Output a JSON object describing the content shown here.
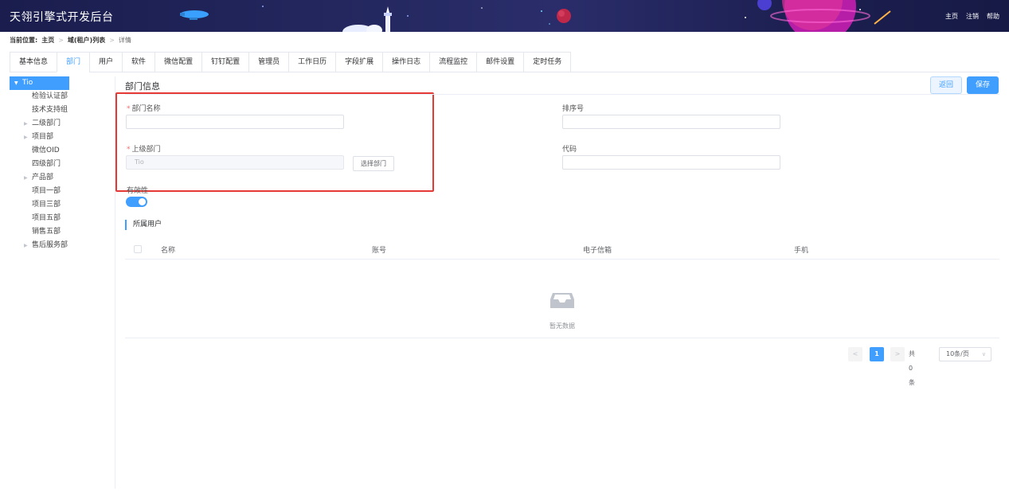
{
  "header": {
    "title": "天翎引擎式开发后台",
    "links": [
      "主页",
      "注销",
      "帮助"
    ]
  },
  "breadcrumb": {
    "label": "当前位置:",
    "items": [
      "主页",
      "域(租户)列表",
      "详情"
    ]
  },
  "tabs": [
    "基本信息",
    "部门",
    "用户",
    "软件",
    "微信配置",
    "钉钉配置",
    "管理员",
    "工作日历",
    "字段扩展",
    "操作日志",
    "流程监控",
    "邮件设置",
    "定时任务"
  ],
  "active_tab": "部门",
  "tree": {
    "root": "Tio",
    "children": [
      {
        "label": "检验认证部",
        "expandable": false
      },
      {
        "label": "技术支持组",
        "expandable": false
      },
      {
        "label": "二级部门",
        "expandable": true
      },
      {
        "label": "项目部",
        "expandable": true
      },
      {
        "label": "微信OID",
        "expandable": false
      },
      {
        "label": "四级部门",
        "expandable": false
      },
      {
        "label": "产品部",
        "expandable": true
      },
      {
        "label": "项目一部",
        "expandable": false
      },
      {
        "label": "项目三部",
        "expandable": false
      },
      {
        "label": "项目五部",
        "expandable": false
      },
      {
        "label": "销售五部",
        "expandable": false
      },
      {
        "label": "售后服务部",
        "expandable": true
      }
    ]
  },
  "form": {
    "section_title": "部门信息",
    "back_label": "返回",
    "save_label": "保存",
    "dept_name_label": "部门名称",
    "dept_name_value": "",
    "order_label": "排序号",
    "order_value": "",
    "parent_label": "上级部门",
    "parent_value": "Tio",
    "select_dept_label": "选择部门",
    "code_label": "代码",
    "code_value": "",
    "valid_label": "有效性",
    "valid_on": true
  },
  "users_table": {
    "title": "所属用户",
    "columns": [
      "名称",
      "账号",
      "电子信箱",
      "手机"
    ],
    "rows": [],
    "empty_text": "暂无数据"
  },
  "pagination": {
    "current_page": "1",
    "total_text": "共 0 条",
    "page_size": "10条/页"
  },
  "colors": {
    "primary": "#409eff",
    "required": "#f56c6c",
    "highlight_box": "#e53935",
    "header_bg": "#1a1d4d"
  }
}
